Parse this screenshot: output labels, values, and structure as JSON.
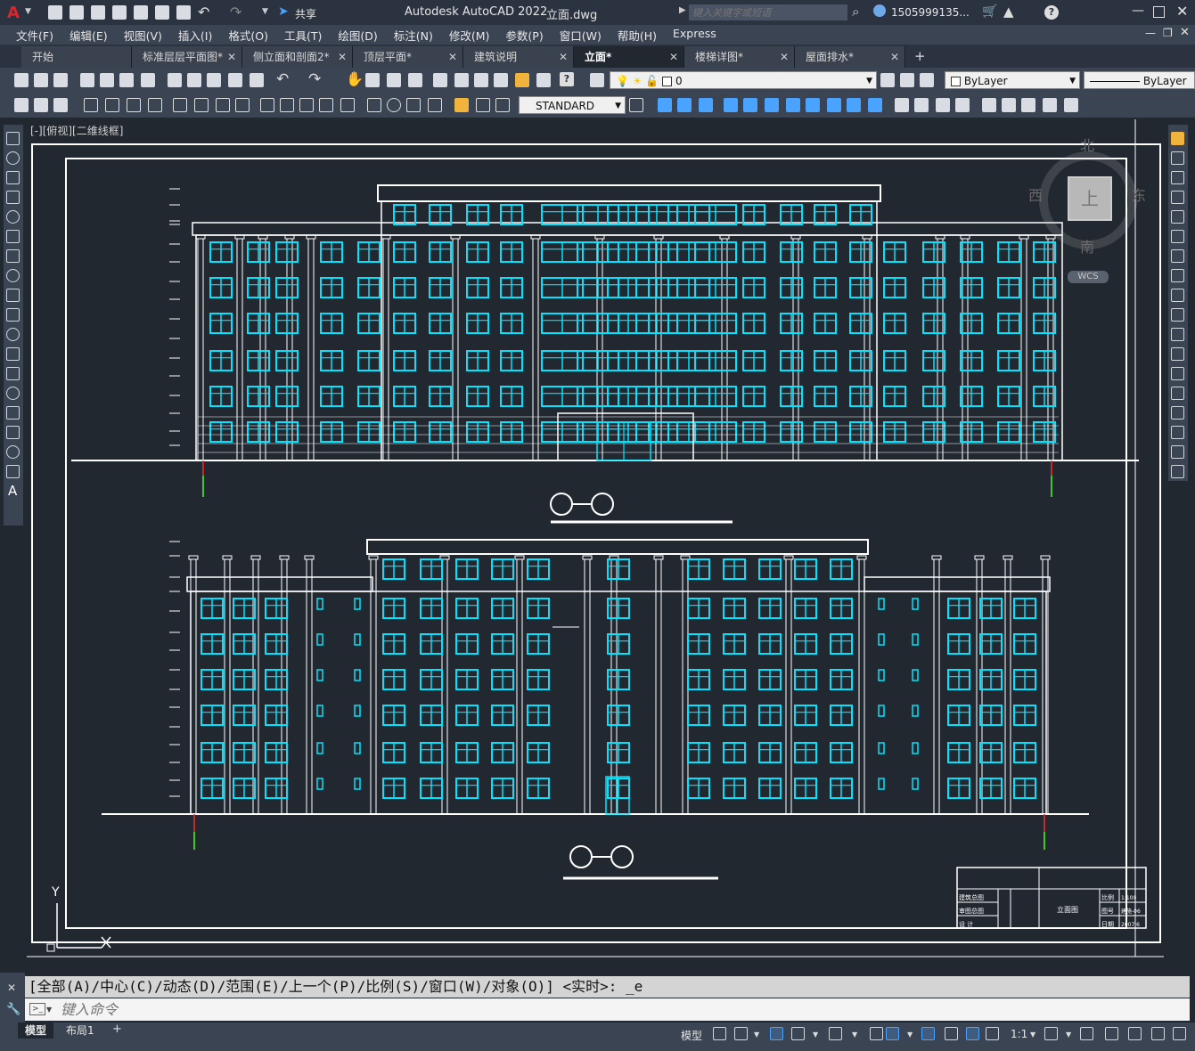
{
  "titlebar": {
    "share_label": "共享",
    "app_title": "Autodesk AutoCAD 2022",
    "file_name": "立面.dwg",
    "search_placeholder": "键入关键字或短语",
    "user_name": "1505999135..."
  },
  "menu": [
    "文件(F)",
    "编辑(E)",
    "视图(V)",
    "插入(I)",
    "格式(O)",
    "工具(T)",
    "绘图(D)",
    "标注(N)",
    "修改(M)",
    "参数(P)",
    "窗口(W)",
    "帮助(H)",
    "Express"
  ],
  "tabs": [
    {
      "label": "开始",
      "closable": false,
      "active": false
    },
    {
      "label": "标准层层平面图*",
      "closable": true,
      "active": false
    },
    {
      "label": "侧立面和剖面2*",
      "closable": true,
      "active": false
    },
    {
      "label": "顶层平面*",
      "closable": true,
      "active": false
    },
    {
      "label": "建筑说明",
      "closable": true,
      "active": false
    },
    {
      "label": "立面*",
      "closable": true,
      "active": true
    },
    {
      "label": "楼梯详图*",
      "closable": true,
      "active": false
    },
    {
      "label": "屋面排水*",
      "closable": true,
      "active": false
    }
  ],
  "toolbar": {
    "layer_value": "0",
    "color_value": "ByLayer",
    "linetype_value": "ByLayer",
    "textstyle_value": "STANDARD"
  },
  "viewport": {
    "label": "[-][俯视][二维线框]",
    "viewcube": {
      "north": "北",
      "south": "南",
      "east": "东",
      "west": "西",
      "top": "上",
      "wcs": "WCS"
    },
    "ucs_y": "Y",
    "title_block": {
      "drawing_name": "立面图",
      "rows_left": [
        "建筑总图",
        "审图总图",
        "设  计"
      ],
      "rows_right_labels": [
        "比例",
        "图号",
        "日期"
      ],
      "rows_right_values": [
        "1:100",
        "建施-06",
        "2007.6"
      ]
    }
  },
  "command": {
    "history": "[全部(A)/中心(C)/动态(D)/范围(E)/上一个(P)/比例(S)/窗口(W)/对象(O)] <实时>: _e",
    "placeholder": "键入命令"
  },
  "status": {
    "model_tab": "模型",
    "layout_tab": "布局1",
    "model_label": "模型",
    "scale": "1:1"
  },
  "colors": {
    "canvas": "#212830",
    "window_cyan": "#00e5ff",
    "line_white": "#ffffff",
    "axis_red": "#ff2a2a",
    "axis_green": "#22ff22"
  }
}
